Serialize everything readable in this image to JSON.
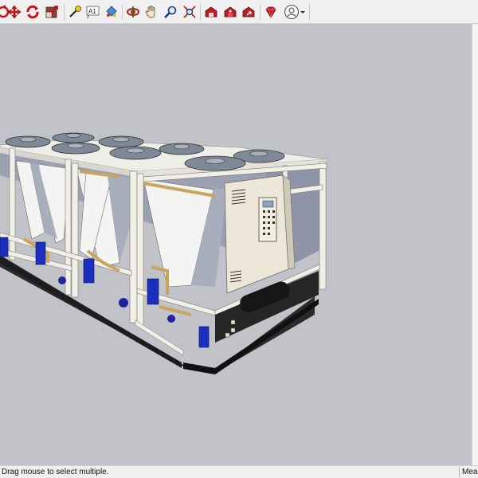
{
  "toolbar": {
    "tools": [
      {
        "id": "orbit-partial",
        "icon": "orbit-icon"
      },
      {
        "id": "move",
        "icon": "move-icon"
      },
      {
        "id": "rotate",
        "icon": "rotate-icon"
      },
      {
        "id": "scale",
        "icon": "scale-icon"
      },
      {
        "id": "tape-measure",
        "icon": "tape-measure-icon"
      },
      {
        "id": "text",
        "icon": "text-icon"
      },
      {
        "id": "paint-bucket",
        "icon": "paint-bucket-icon"
      },
      {
        "id": "orbit",
        "icon": "orbit-icon"
      },
      {
        "id": "pan",
        "icon": "pan-hand-icon"
      },
      {
        "id": "zoom",
        "icon": "zoom-icon"
      },
      {
        "id": "zoom-extents",
        "icon": "zoom-extents-icon"
      },
      {
        "id": "warehouse",
        "icon": "3d-warehouse-icon"
      },
      {
        "id": "extension-warehouse",
        "icon": "extension-warehouse-icon"
      },
      {
        "id": "share-model",
        "icon": "share-model-icon"
      },
      {
        "id": "extension-manager",
        "icon": "ruby-gem-icon"
      },
      {
        "id": "account",
        "icon": "user-account-icon"
      }
    ],
    "text_tool_label": "A1"
  },
  "status": {
    "hint": "Drag mouse to select multiple.",
    "measurements_label": "Meas"
  },
  "colors": {
    "viewport_background": "#c2c3c9",
    "frame": "#ece8e0",
    "coil": "#9ba0b3",
    "pipe_copper": "#c9a560",
    "compressor_blue": "#1a2ec0",
    "control_panel": "#ece7d6",
    "toolbar": "#f0f0f0"
  },
  "model": {
    "description_icon": "chiller-unit"
  }
}
